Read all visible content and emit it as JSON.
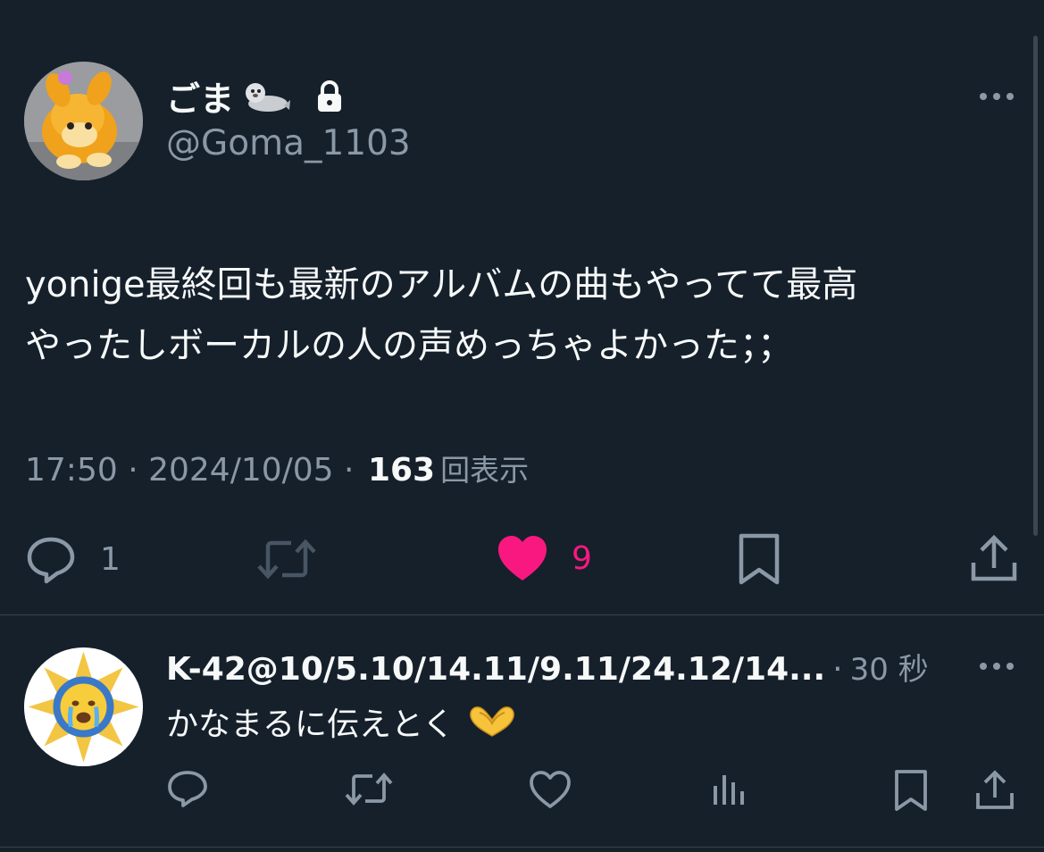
{
  "tweet": {
    "display_name": "ごま",
    "handle": "@Goma_1103",
    "text": "yonige最終回も最新のアルバムの曲もやってて最高\nやったしボーカルの人の声めっちゃよかった；；",
    "time": "17:50",
    "date": "2024/10/05",
    "views_count": "163",
    "views_label": "回表示",
    "reply_count": "1",
    "like_count": "9",
    "liked": true
  },
  "reply": {
    "display_name": "K-42@10/5.10/14.11/9.11/24.12/14...",
    "time": "30 秒",
    "text": "かなまるに伝えとく"
  },
  "colors": {
    "background": "#15202b",
    "secondary_text": "#8b98a5",
    "like_pink": "#f91880",
    "divider": "#38444d"
  },
  "icons": {
    "name_emoji": "seal-icon",
    "protected": "lock-icon",
    "reply_emoji": "heart-hands-icon"
  }
}
